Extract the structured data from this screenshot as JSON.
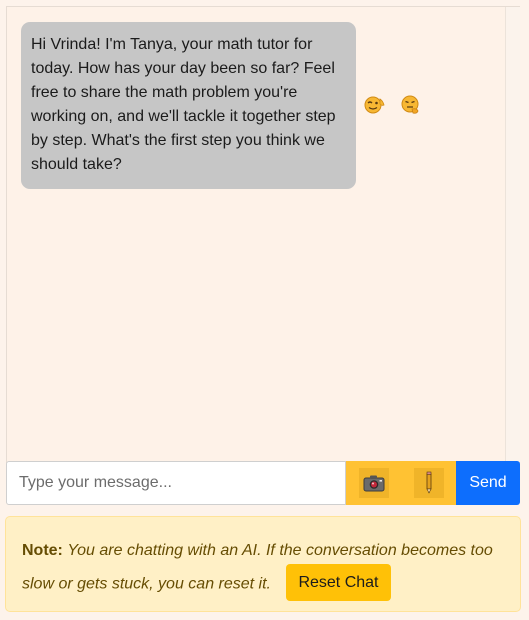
{
  "chat": {
    "messages": [
      {
        "sender": "bot",
        "text": "Hi Vrinda! I'm Tanya, your math tutor for today. How has your day been so far? Feel free to share the math problem you're working on, and we'll tackle it together step by step. What's the first step you think we should take?"
      }
    ],
    "reaction_icons": [
      "wink-face-icon",
      "thinking-face-icon"
    ]
  },
  "composer": {
    "placeholder": "Type your message...",
    "value": "",
    "camera_icon": "camera-icon",
    "pencil_icon": "pencil-icon",
    "send_label": "Send"
  },
  "note": {
    "label": "Note:",
    "text": "You are chatting with an AI. If the conversation becomes too slow or gets stuck, you can reset it.",
    "reset_label": "Reset Chat"
  },
  "colors": {
    "background": "#fdf3eb",
    "bubble": "#c6c6c6",
    "tool_accent": "#ffc233",
    "send": "#0d6efd",
    "reset": "#ffc107",
    "note_bg": "#fff0c6",
    "note_text": "#664d03"
  }
}
